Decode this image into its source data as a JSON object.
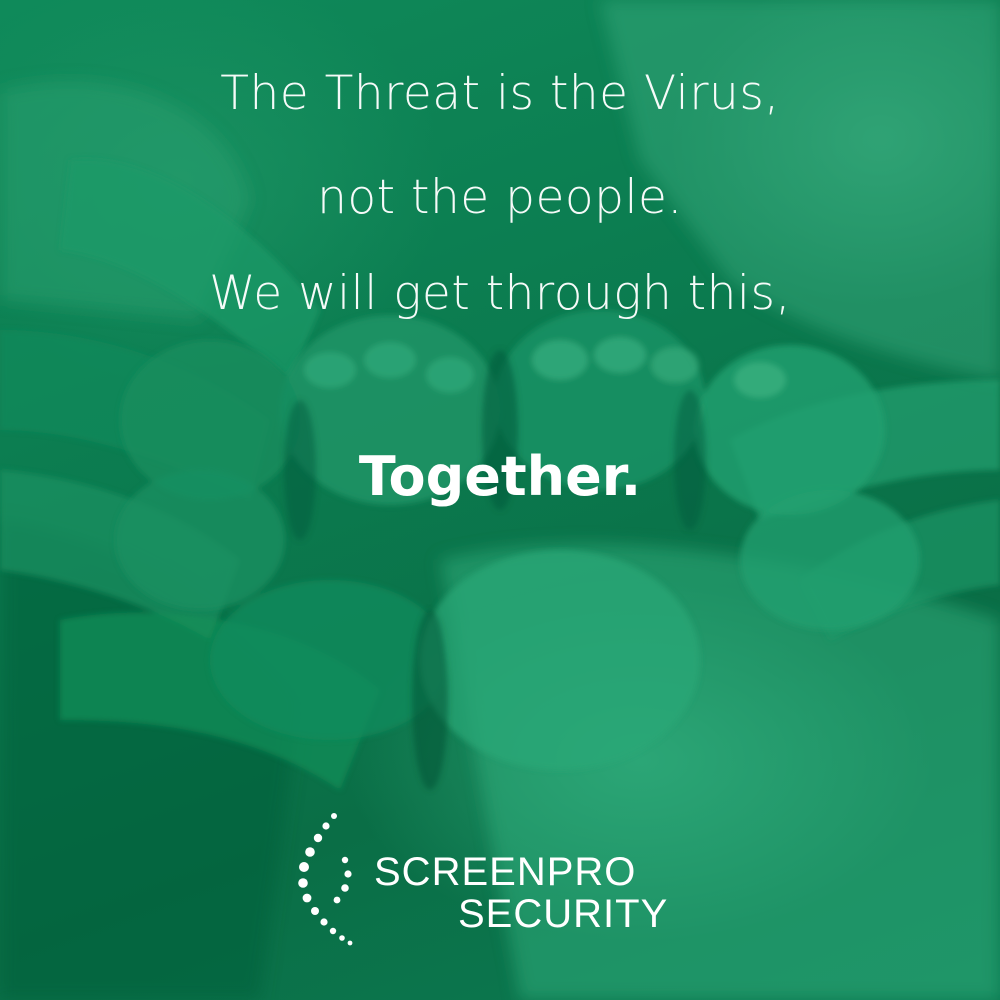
{
  "message": {
    "line1": "The Threat is the Virus,",
    "line2": "not the people.",
    "line3": "We will get through this,",
    "headline": "Together."
  },
  "logo": {
    "word1": "SCREENPRO",
    "word2": "SECURITY",
    "icon": "dotted-spiral-icon"
  },
  "colors": {
    "overlay_green": "#0b7b4f",
    "text": "#ffffff"
  }
}
